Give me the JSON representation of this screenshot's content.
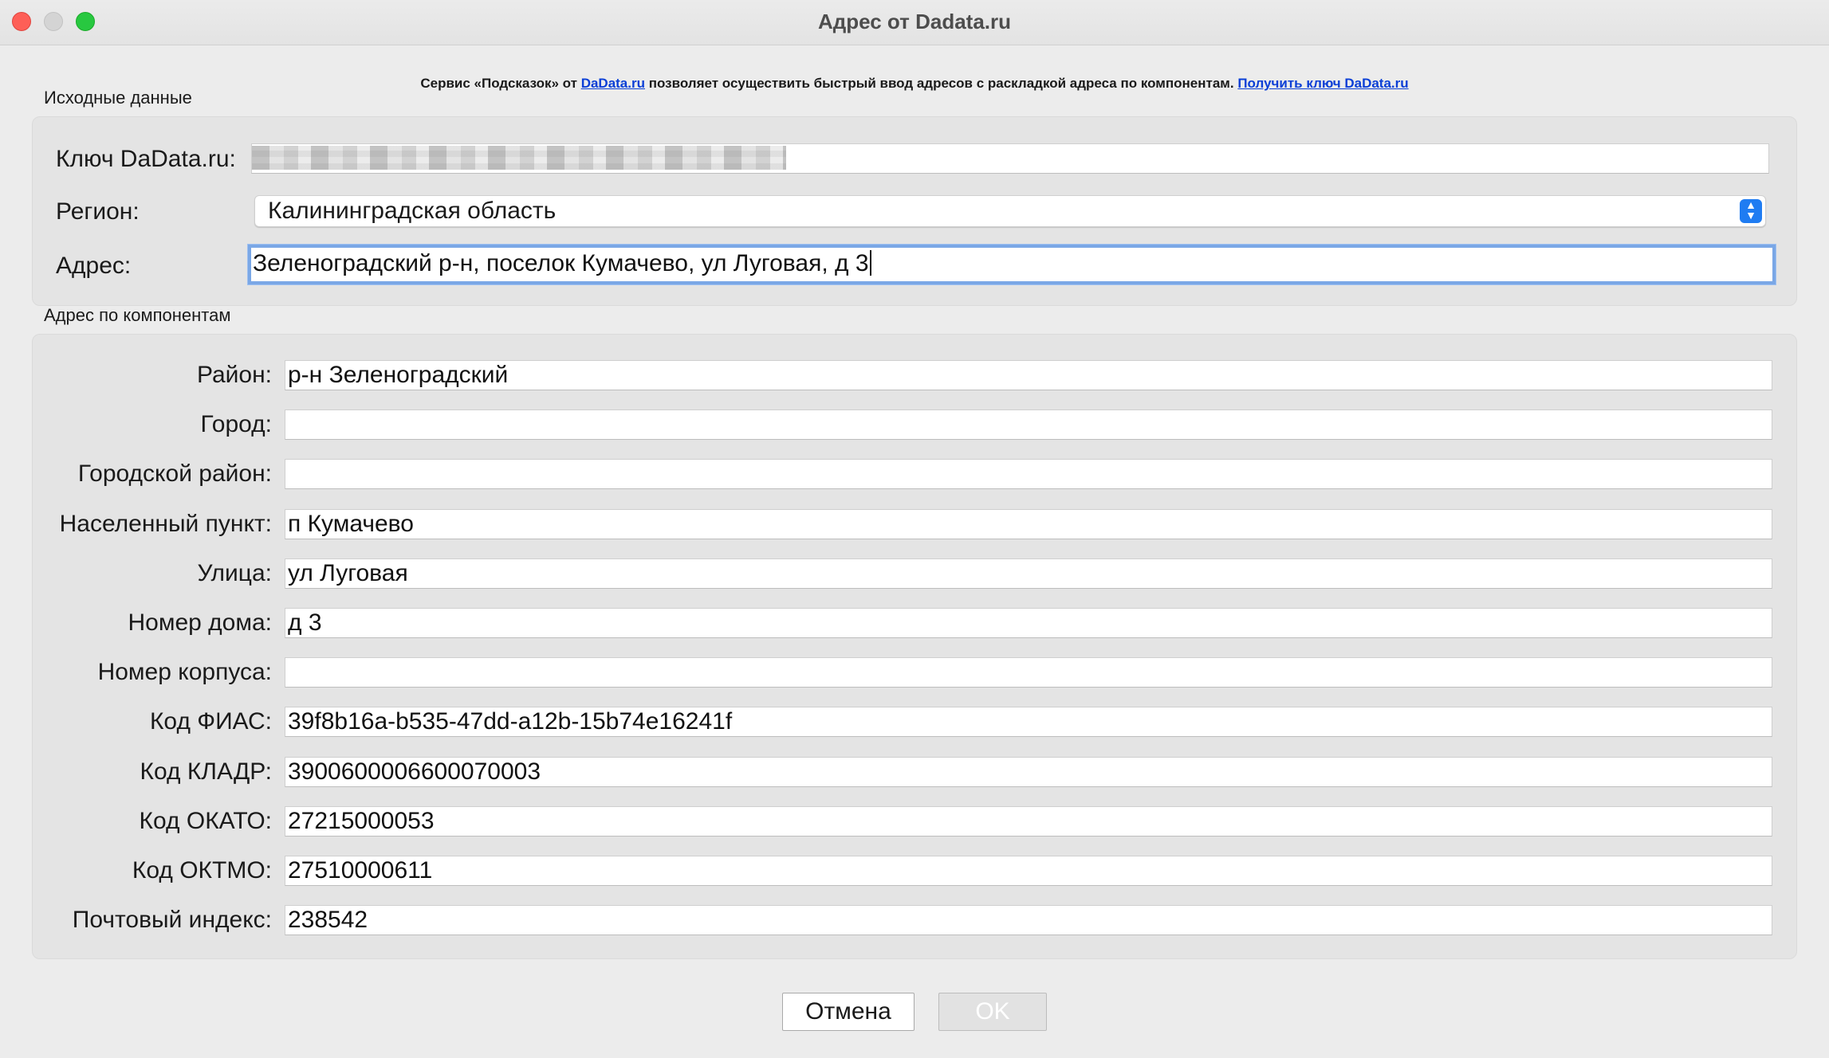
{
  "window": {
    "title": "Адрес от Dadata.ru"
  },
  "info": {
    "prefix": "Сервис «Подсказок» от ",
    "link1": "DaData.ru",
    "middle": " позволяет осуществить быстрый ввод адресов с раскладкой адреса по компонентам. ",
    "link2": "Получить ключ DaData.ru"
  },
  "source": {
    "group_label": "Исходные данные",
    "key_label": "Ключ DaData.ru:",
    "key_value": "",
    "region_label": "Регион:",
    "region_value": "Калининградская область",
    "address_label": "Адрес:",
    "address_value": "Зеленоградский р-н, поселок Кумачево, ул Луговая, д 3"
  },
  "components": {
    "group_label": "Адрес по компонентам",
    "rows": [
      {
        "label": "Район:",
        "value": "р-н Зеленоградский"
      },
      {
        "label": "Город:",
        "value": ""
      },
      {
        "label": "Городской район:",
        "value": ""
      },
      {
        "label": "Населенный пункт:",
        "value": "п Кумачево"
      },
      {
        "label": "Улица:",
        "value": "ул Луговая"
      },
      {
        "label": "Номер дома:",
        "value": "д 3"
      },
      {
        "label": "Номер корпуса:",
        "value": ""
      },
      {
        "label": "Код ФИАС:",
        "value": "39f8b16a-b535-47dd-a12b-15b74e16241f"
      },
      {
        "label": "Код КЛАДР:",
        "value": "3900600006600070003"
      },
      {
        "label": "Код ОКАТО:",
        "value": "27215000053"
      },
      {
        "label": "Код ОКТМО:",
        "value": "27510000611"
      },
      {
        "label": "Почтовый индекс:",
        "value": "238542"
      }
    ]
  },
  "buttons": {
    "cancel": "Отмена",
    "ok": "OK"
  }
}
